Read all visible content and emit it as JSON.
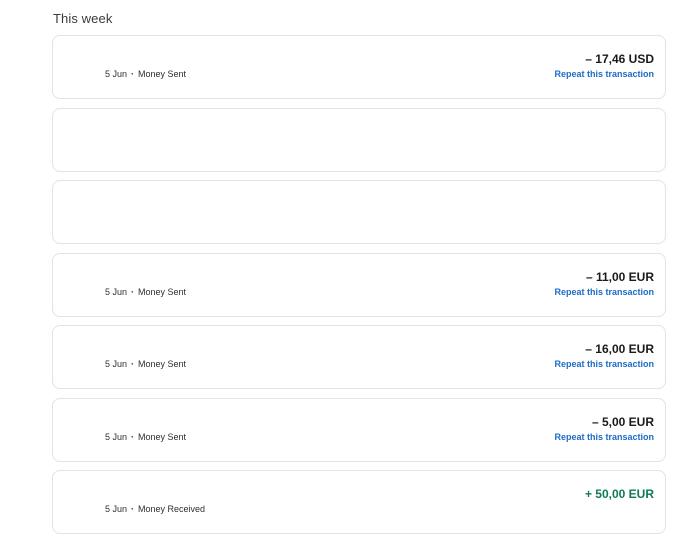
{
  "section": {
    "title": "This week"
  },
  "transactions": [
    {
      "date": "5 Jun",
      "separator": "·",
      "type": "Money Sent",
      "amount": "– 17,46 USD",
      "repeat_label": "Repeat this transaction"
    },
    {},
    {},
    {
      "date": "5 Jun",
      "separator": "·",
      "type": "Money Sent",
      "amount": "– 11,00 EUR",
      "repeat_label": "Repeat this transaction"
    },
    {
      "date": "5 Jun",
      "separator": "·",
      "type": "Money Sent",
      "amount": "– 16,00 EUR",
      "repeat_label": "Repeat this transaction"
    },
    {
      "date": "5 Jun",
      "separator": "·",
      "type": "Money Sent",
      "amount": "– 5,00 EUR",
      "repeat_label": "Repeat this transaction"
    },
    {
      "date": "5 Jun",
      "separator": "·",
      "type": "Money Received",
      "amount": "+ 50,00 EUR"
    }
  ],
  "colors": {
    "received_amount": "#0e7a5a",
    "repeat_link": "#1e6bc4",
    "card_border": "#e3e3e3"
  }
}
